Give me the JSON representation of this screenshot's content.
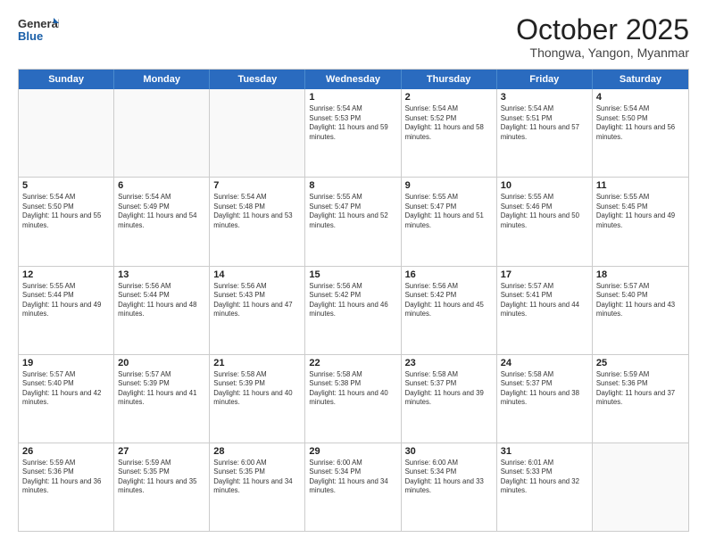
{
  "logo": {
    "line1": "General",
    "line2": "Blue"
  },
  "header": {
    "month": "October 2025",
    "location": "Thongwa, Yangon, Myanmar"
  },
  "days_of_week": [
    "Sunday",
    "Monday",
    "Tuesday",
    "Wednesday",
    "Thursday",
    "Friday",
    "Saturday"
  ],
  "weeks": [
    [
      {
        "day": "",
        "sunrise": "",
        "sunset": "",
        "daylight": ""
      },
      {
        "day": "",
        "sunrise": "",
        "sunset": "",
        "daylight": ""
      },
      {
        "day": "",
        "sunrise": "",
        "sunset": "",
        "daylight": ""
      },
      {
        "day": "1",
        "sunrise": "Sunrise: 5:54 AM",
        "sunset": "Sunset: 5:53 PM",
        "daylight": "Daylight: 11 hours and 59 minutes."
      },
      {
        "day": "2",
        "sunrise": "Sunrise: 5:54 AM",
        "sunset": "Sunset: 5:52 PM",
        "daylight": "Daylight: 11 hours and 58 minutes."
      },
      {
        "day": "3",
        "sunrise": "Sunrise: 5:54 AM",
        "sunset": "Sunset: 5:51 PM",
        "daylight": "Daylight: 11 hours and 57 minutes."
      },
      {
        "day": "4",
        "sunrise": "Sunrise: 5:54 AM",
        "sunset": "Sunset: 5:50 PM",
        "daylight": "Daylight: 11 hours and 56 minutes."
      }
    ],
    [
      {
        "day": "5",
        "sunrise": "Sunrise: 5:54 AM",
        "sunset": "Sunset: 5:50 PM",
        "daylight": "Daylight: 11 hours and 55 minutes."
      },
      {
        "day": "6",
        "sunrise": "Sunrise: 5:54 AM",
        "sunset": "Sunset: 5:49 PM",
        "daylight": "Daylight: 11 hours and 54 minutes."
      },
      {
        "day": "7",
        "sunrise": "Sunrise: 5:54 AM",
        "sunset": "Sunset: 5:48 PM",
        "daylight": "Daylight: 11 hours and 53 minutes."
      },
      {
        "day": "8",
        "sunrise": "Sunrise: 5:55 AM",
        "sunset": "Sunset: 5:47 PM",
        "daylight": "Daylight: 11 hours and 52 minutes."
      },
      {
        "day": "9",
        "sunrise": "Sunrise: 5:55 AM",
        "sunset": "Sunset: 5:47 PM",
        "daylight": "Daylight: 11 hours and 51 minutes."
      },
      {
        "day": "10",
        "sunrise": "Sunrise: 5:55 AM",
        "sunset": "Sunset: 5:46 PM",
        "daylight": "Daylight: 11 hours and 50 minutes."
      },
      {
        "day": "11",
        "sunrise": "Sunrise: 5:55 AM",
        "sunset": "Sunset: 5:45 PM",
        "daylight": "Daylight: 11 hours and 49 minutes."
      }
    ],
    [
      {
        "day": "12",
        "sunrise": "Sunrise: 5:55 AM",
        "sunset": "Sunset: 5:44 PM",
        "daylight": "Daylight: 11 hours and 49 minutes."
      },
      {
        "day": "13",
        "sunrise": "Sunrise: 5:56 AM",
        "sunset": "Sunset: 5:44 PM",
        "daylight": "Daylight: 11 hours and 48 minutes."
      },
      {
        "day": "14",
        "sunrise": "Sunrise: 5:56 AM",
        "sunset": "Sunset: 5:43 PM",
        "daylight": "Daylight: 11 hours and 47 minutes."
      },
      {
        "day": "15",
        "sunrise": "Sunrise: 5:56 AM",
        "sunset": "Sunset: 5:42 PM",
        "daylight": "Daylight: 11 hours and 46 minutes."
      },
      {
        "day": "16",
        "sunrise": "Sunrise: 5:56 AM",
        "sunset": "Sunset: 5:42 PM",
        "daylight": "Daylight: 11 hours and 45 minutes."
      },
      {
        "day": "17",
        "sunrise": "Sunrise: 5:57 AM",
        "sunset": "Sunset: 5:41 PM",
        "daylight": "Daylight: 11 hours and 44 minutes."
      },
      {
        "day": "18",
        "sunrise": "Sunrise: 5:57 AM",
        "sunset": "Sunset: 5:40 PM",
        "daylight": "Daylight: 11 hours and 43 minutes."
      }
    ],
    [
      {
        "day": "19",
        "sunrise": "Sunrise: 5:57 AM",
        "sunset": "Sunset: 5:40 PM",
        "daylight": "Daylight: 11 hours and 42 minutes."
      },
      {
        "day": "20",
        "sunrise": "Sunrise: 5:57 AM",
        "sunset": "Sunset: 5:39 PM",
        "daylight": "Daylight: 11 hours and 41 minutes."
      },
      {
        "day": "21",
        "sunrise": "Sunrise: 5:58 AM",
        "sunset": "Sunset: 5:39 PM",
        "daylight": "Daylight: 11 hours and 40 minutes."
      },
      {
        "day": "22",
        "sunrise": "Sunrise: 5:58 AM",
        "sunset": "Sunset: 5:38 PM",
        "daylight": "Daylight: 11 hours and 40 minutes."
      },
      {
        "day": "23",
        "sunrise": "Sunrise: 5:58 AM",
        "sunset": "Sunset: 5:37 PM",
        "daylight": "Daylight: 11 hours and 39 minutes."
      },
      {
        "day": "24",
        "sunrise": "Sunrise: 5:58 AM",
        "sunset": "Sunset: 5:37 PM",
        "daylight": "Daylight: 11 hours and 38 minutes."
      },
      {
        "day": "25",
        "sunrise": "Sunrise: 5:59 AM",
        "sunset": "Sunset: 5:36 PM",
        "daylight": "Daylight: 11 hours and 37 minutes."
      }
    ],
    [
      {
        "day": "26",
        "sunrise": "Sunrise: 5:59 AM",
        "sunset": "Sunset: 5:36 PM",
        "daylight": "Daylight: 11 hours and 36 minutes."
      },
      {
        "day": "27",
        "sunrise": "Sunrise: 5:59 AM",
        "sunset": "Sunset: 5:35 PM",
        "daylight": "Daylight: 11 hours and 35 minutes."
      },
      {
        "day": "28",
        "sunrise": "Sunrise: 6:00 AM",
        "sunset": "Sunset: 5:35 PM",
        "daylight": "Daylight: 11 hours and 34 minutes."
      },
      {
        "day": "29",
        "sunrise": "Sunrise: 6:00 AM",
        "sunset": "Sunset: 5:34 PM",
        "daylight": "Daylight: 11 hours and 34 minutes."
      },
      {
        "day": "30",
        "sunrise": "Sunrise: 6:00 AM",
        "sunset": "Sunset: 5:34 PM",
        "daylight": "Daylight: 11 hours and 33 minutes."
      },
      {
        "day": "31",
        "sunrise": "Sunrise: 6:01 AM",
        "sunset": "Sunset: 5:33 PM",
        "daylight": "Daylight: 11 hours and 32 minutes."
      },
      {
        "day": "",
        "sunrise": "",
        "sunset": "",
        "daylight": ""
      }
    ]
  ]
}
